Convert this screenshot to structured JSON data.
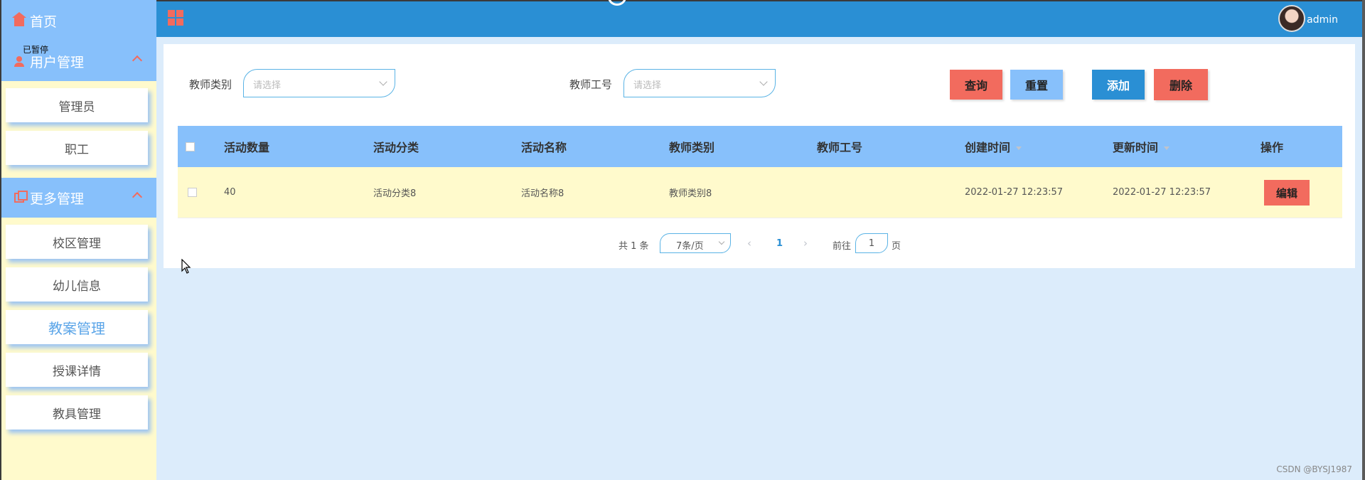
{
  "sidebar": {
    "home_label": "首页",
    "overlay_tag": "已暂停",
    "groups": [
      {
        "label": "用户管理",
        "items": [
          "管理员",
          "职工"
        ]
      },
      {
        "label": "更多管理",
        "items": [
          "校区管理",
          "幼儿信息",
          "教案管理",
          "授课详情",
          "教具管理"
        ]
      }
    ],
    "active_item": "教案管理"
  },
  "header": {
    "username": "admin"
  },
  "filters": {
    "teacher_type": {
      "label": "教师类别",
      "placeholder": "请选择"
    },
    "teacher_no": {
      "label": "教师工号",
      "placeholder": "请选择"
    }
  },
  "toolbar": {
    "query": "查询",
    "reset": "重置",
    "add": "添加",
    "delete": "删除"
  },
  "table": {
    "columns": [
      "活动数量",
      "活动分类",
      "活动名称",
      "教师类别",
      "教师工号",
      "创建时间",
      "更新时间",
      "操作"
    ],
    "rows": [
      {
        "count": "40",
        "category": "活动分类8",
        "name": "活动名称8",
        "teacher_type": "教师类别8",
        "teacher_no": "",
        "created": "2022-01-27 12:23:57",
        "updated": "2022-01-27 12:23:57",
        "action": "编辑"
      }
    ]
  },
  "pagination": {
    "total": "共 1 条",
    "page_size": "7条/页",
    "current_page": "1",
    "goto_label": "前往",
    "goto_value": "1",
    "page_suffix": "页"
  },
  "watermark": "CSDN @BYSJ1987",
  "colors": {
    "primary": "#2a8fd4",
    "light_blue": "#87c0fb",
    "coral": "#f26b5e",
    "cream": "#fffacc",
    "background": "#dcecfb"
  }
}
